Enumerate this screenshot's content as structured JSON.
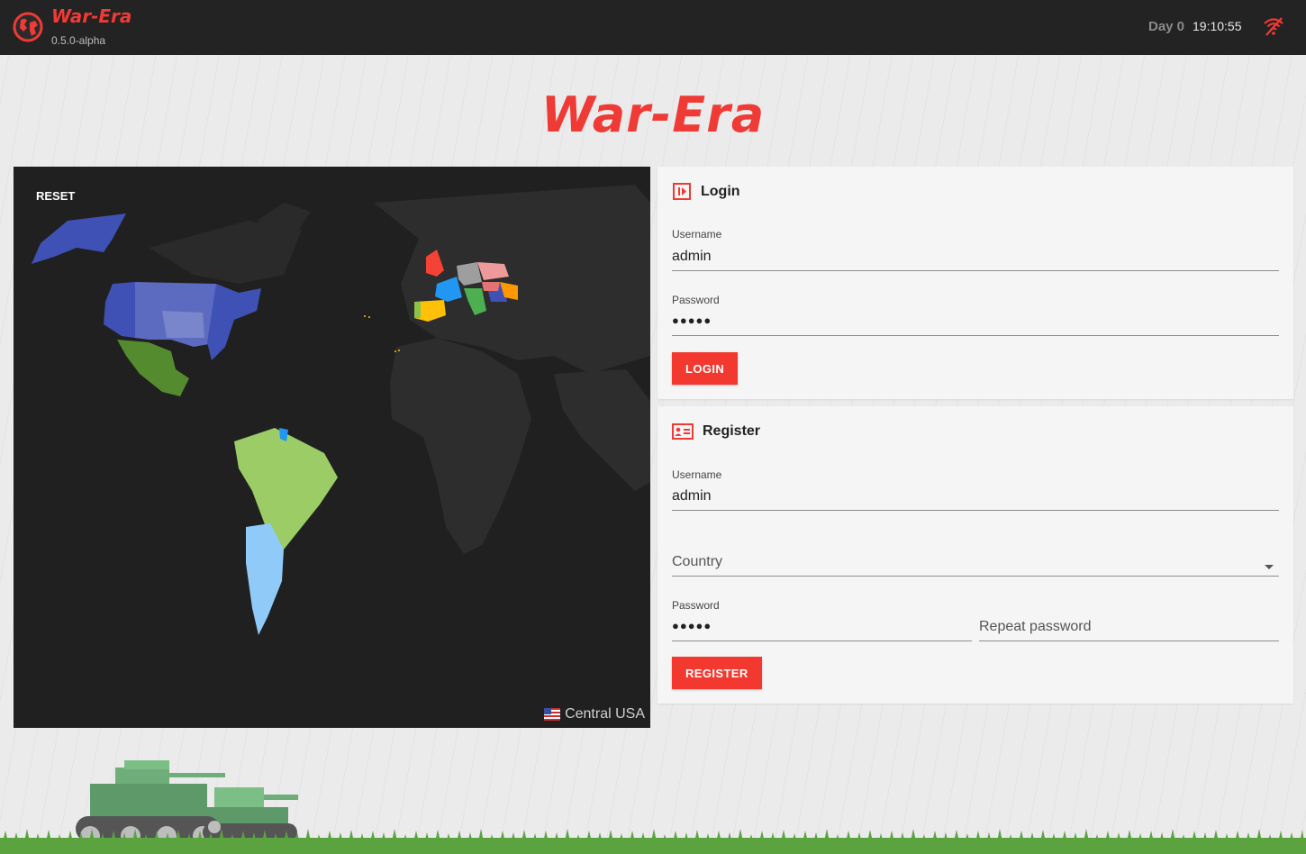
{
  "app": {
    "name": "War-Era",
    "version": "0.5.0-alpha"
  },
  "header": {
    "day": "Day 0",
    "time": "19:10:55"
  },
  "hero": {
    "title": "War-Era"
  },
  "map": {
    "reset_label": "RESET",
    "selected_region": "Central USA"
  },
  "login": {
    "title": "Login",
    "username_label": "Username",
    "username_value": "admin",
    "password_label": "Password",
    "password_value": "●●●●●",
    "button_label": "LOGIN"
  },
  "register": {
    "title": "Register",
    "username_label": "Username",
    "username_value": "admin",
    "country_placeholder": "Country",
    "password_label": "Password",
    "password_value": "●●●●●",
    "repeat_password_placeholder": "Repeat password",
    "button_label": "REGISTER"
  },
  "colors": {
    "accent": "#f3382f",
    "topbar": "#232323",
    "map_bg": "#202020"
  }
}
